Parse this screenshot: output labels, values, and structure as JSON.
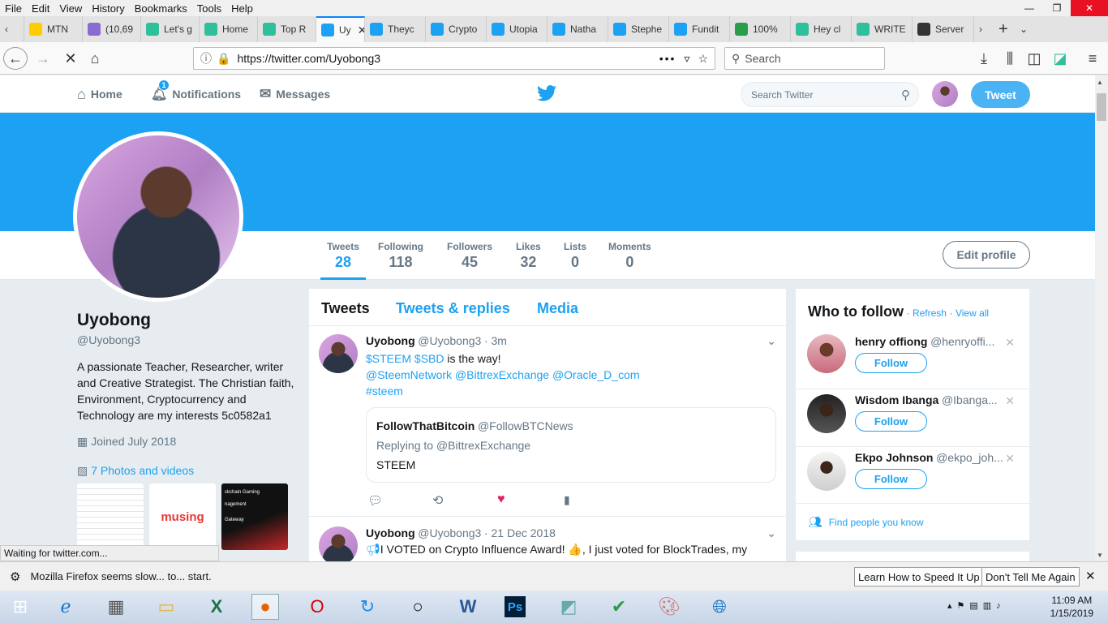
{
  "menubar": {
    "items": [
      "File",
      "Edit",
      "View",
      "History",
      "Bookmarks",
      "Tools",
      "Help"
    ]
  },
  "tabs": [
    {
      "label": "MTN",
      "color": "#ffcc00"
    },
    {
      "label": "(10,69",
      "color": "#8a6bd1"
    },
    {
      "label": "Let's g",
      "color": "#2fbf9b"
    },
    {
      "label": "Home",
      "color": "#2fbf9b"
    },
    {
      "label": "Top R",
      "color": "#2fbf9b"
    },
    {
      "label": "Uy",
      "color": "#1da1f2",
      "active": true
    },
    {
      "label": "Theyc",
      "color": "#1da1f2"
    },
    {
      "label": "Crypto",
      "color": "#1da1f2"
    },
    {
      "label": "Utopia",
      "color": "#1da1f2"
    },
    {
      "label": "Natha",
      "color": "#1da1f2"
    },
    {
      "label": "Stephe",
      "color": "#1da1f2"
    },
    {
      "label": "Fundit",
      "color": "#1da1f2"
    },
    {
      "label": "100%",
      "color": "#2a9d4a"
    },
    {
      "label": "Hey cl",
      "color": "#2fbf9b"
    },
    {
      "label": "WRITE",
      "color": "#2fbf9b"
    },
    {
      "label": "Server",
      "color": "#333333"
    }
  ],
  "browser": {
    "url": "https://twitter.com/Uyobong3",
    "search_placeholder": "Search",
    "status": "Waiting for twitter.com...",
    "notification": "Mozilla Firefox seems slow... to... start.",
    "notif_btn1": "Learn How to Speed It Up",
    "notif_btn2": "Don't Tell Me Again"
  },
  "twnav": {
    "home": "Home",
    "notifications": "Notifications",
    "notif_count": "1",
    "messages": "Messages",
    "search_placeholder": "Search Twitter",
    "tweet": "Tweet"
  },
  "stats": [
    {
      "label": "Tweets",
      "value": "28"
    },
    {
      "label": "Following",
      "value": "118"
    },
    {
      "label": "Followers",
      "value": "45"
    },
    {
      "label": "Likes",
      "value": "32"
    },
    {
      "label": "Lists",
      "value": "0"
    },
    {
      "label": "Moments",
      "value": "0"
    }
  ],
  "edit_profile": "Edit profile",
  "profile": {
    "name": "Uyobong",
    "handle": "@Uyobong3",
    "bio": "A passionate Teacher, Researcher, writer and Creative Strategist. The Christian faith, Environment, Cryptocurrency and Technology are my interests 5c0582a1",
    "joined": "Joined July 2018",
    "photos": "7 Photos and videos",
    "thumb2": "musing",
    "thumb3a": "ckchain Gaming",
    "thumb3b": "nagement",
    "thumb3c": "Gateway"
  },
  "timeline": {
    "tabs": [
      "Tweets",
      "Tweets & replies",
      "Media"
    ],
    "tweet1": {
      "name": "Uyobong",
      "handle": "@Uyobong3",
      "time": "· 3m",
      "tags1": "$STEEM $SBD",
      "text1": " is the way!",
      "mentions": "@SteemNetwork @BittrexExchange @Oracle_D_com",
      "hashtag": "#steem",
      "quote_name": "FollowThatBitcoin",
      "quote_handle": "@FollowBTCNews",
      "quote_reply": "Replying to @BittrexExchange",
      "quote_text": "STEEM"
    },
    "tweet2": {
      "name": "Uyobong",
      "handle": "@Uyobong3",
      "time": "· 21 Dec 2018",
      "text": "I VOTED on Crypto Influence Award! 👍, I just voted for BlockTrades, my"
    }
  },
  "who_to_follow": {
    "title": "Who to follow",
    "refresh": "Refresh",
    "view_all": "View all",
    "follow_label": "Follow",
    "people": [
      {
        "name": "henry offiong",
        "handle": "@henryoffi..."
      },
      {
        "name": "Wisdom Ibanga",
        "handle": "@Ibanga..."
      },
      {
        "name": "Ekpo Johnson",
        "handle": "@ekpo_joh..."
      }
    ],
    "find": "Find people you know"
  },
  "clock": {
    "time": "11:09 AM",
    "date": "1/15/2019"
  }
}
